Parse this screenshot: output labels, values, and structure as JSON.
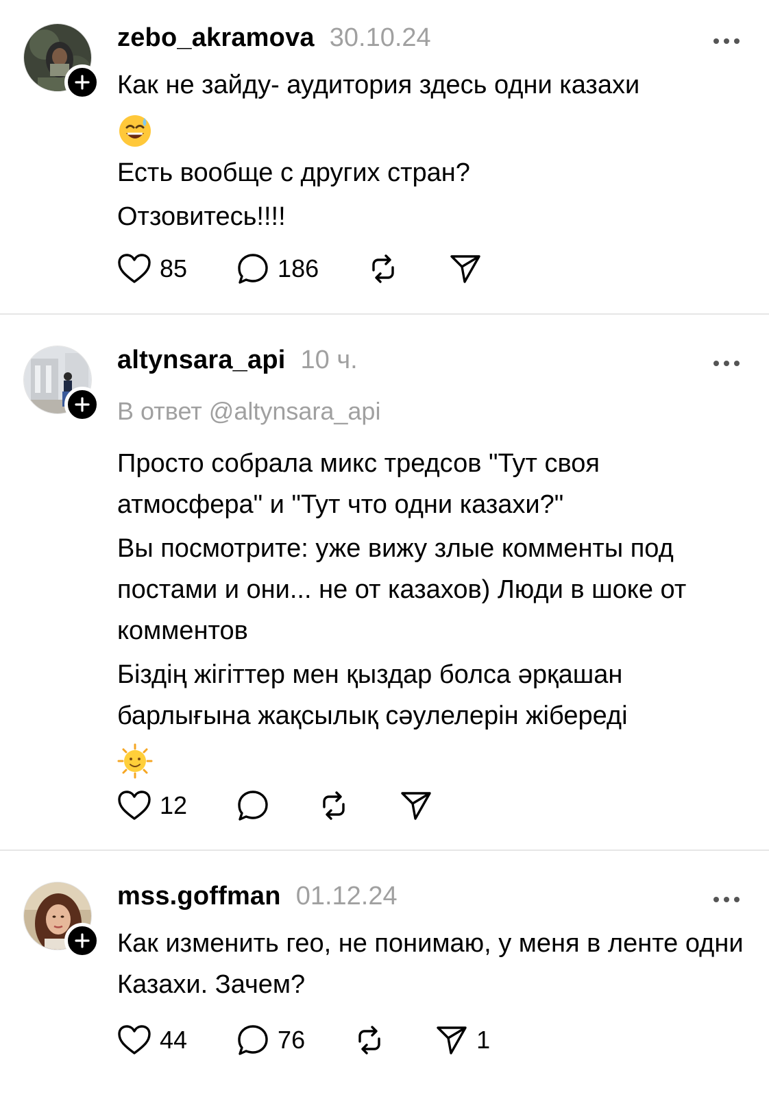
{
  "posts": [
    {
      "username": "zebo_akramova",
      "time": "30.10.24",
      "paragraphs": [
        "Как не зайду- аудитория здесь одни казахи",
        "😅",
        "Есть вообще с других стран?",
        "Отзовитесь!!!!"
      ],
      "likes": "85",
      "comments": "186",
      "shares": ""
    },
    {
      "username": "altynsara_api",
      "time": "10 ч.",
      "reply_to": "В ответ @altynsara_api",
      "paragraphs": [
        "Просто собрала микс тредсов \"Тут своя атмосфера\" и \"Тут что одни казахи?\"",
        "Вы посмотрите: уже вижу злые комменты под постами и они... не от казахов) Люди в шоке от комментов",
        "Біздің жігіттер мен қыздар болса әрқашан барлығына жақсылық сәулелерін жібереді",
        "🌞"
      ],
      "likes": "12",
      "comments": "",
      "shares": ""
    },
    {
      "username": "mss.goffman",
      "time": "01.12.24",
      "paragraphs": [
        "Как изменить гео, не понимаю, у меня в ленте одни Казахи. Зачем?"
      ],
      "likes": "44",
      "comments": "76",
      "shares": "1"
    }
  ],
  "icons": {
    "like": "heart-icon",
    "comment": "comment-bubble-icon",
    "repost": "repost-icon",
    "share": "share-send-icon",
    "more": "more-dots-icon",
    "follow": "plus-icon"
  }
}
